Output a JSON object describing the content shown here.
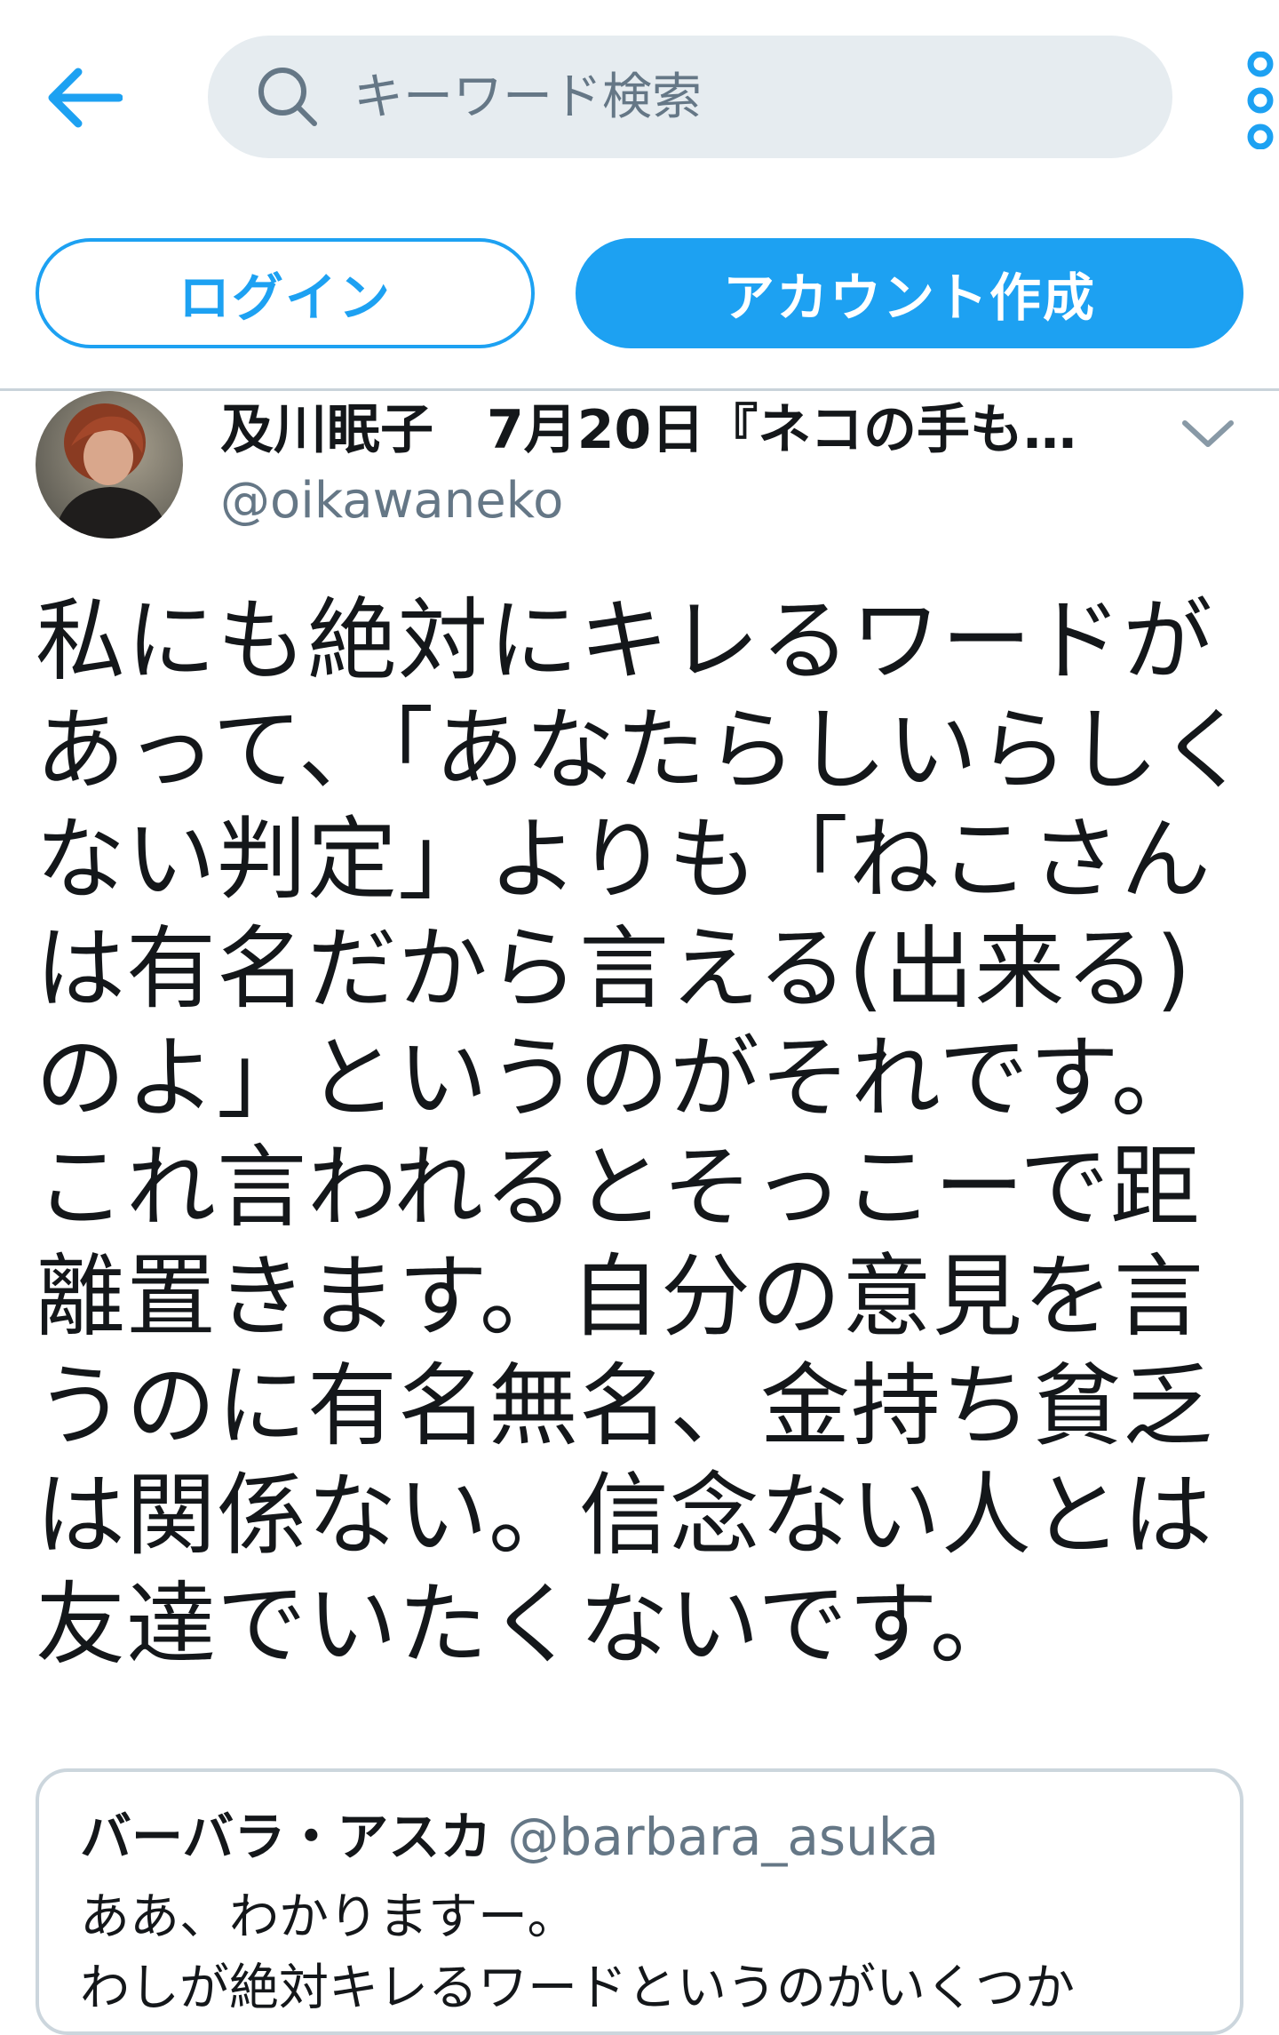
{
  "search": {
    "placeholder": "キーワード検索"
  },
  "auth": {
    "login_label": "ログイン",
    "signup_label": "アカウント作成"
  },
  "tweet": {
    "display_name_line": "及川眠子　7月20日『ネコの手も…",
    "username": "@oikawaneko",
    "text": "私にも絶対にキレるワードがあって、「あなたらしいらしくない判定」よりも「ねこさんは有名だから言える(出来る)のよ」というのがそれです。これ言われるとそっこーで距離置きます。自分の意見を言うのに有名無名、金持ち貧乏は関係ない。信念ない人とは友達でいたくないです。"
  },
  "quote": {
    "name": "バーバラ・アスカ",
    "handle": "@barbara_asuka",
    "text_lines": "ああ、わかりますー。\nわしが絶対キレるワードというのがいくつか"
  },
  "colors": {
    "accent": "#1da1f2",
    "search_bg": "#e6ecf0",
    "muted_text": "#657786",
    "primary_text": "#14171a",
    "divider": "#c9d3da"
  },
  "icons": {
    "back": "arrow-left-icon",
    "search": "search-icon",
    "more": "more-vertical-icon",
    "caret": "chevron-down-icon"
  }
}
